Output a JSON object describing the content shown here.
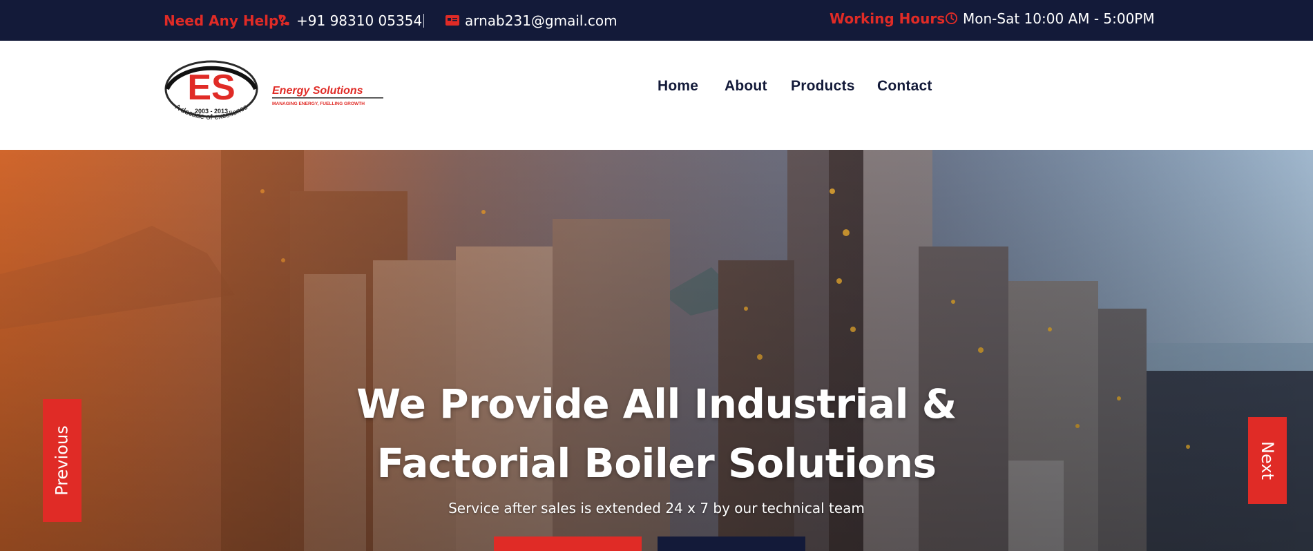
{
  "topbar": {
    "help_label": "Need Any Help?",
    "phone": "+91 98310 05354",
    "email": "arnab231@gmail.com",
    "working_hours_label": "Working Hours",
    "hours": "Mon-Sat 10:00 AM - 5:00PM",
    "icons": [
      "phone-icon",
      "email-icon",
      "clock-icon"
    ]
  },
  "logo": {
    "mark": "ES",
    "years": "2003 - 2013",
    "tagline_arc": "A decade of excellence",
    "name": "Energy Solutions",
    "slogan": "MANAGING ENERGY, FUELLING GROWTH"
  },
  "nav": {
    "items": [
      {
        "label": "Home"
      },
      {
        "label": "About"
      },
      {
        "label": "Products"
      },
      {
        "label": "Contact"
      }
    ]
  },
  "hero": {
    "title_line1": "We Provide All Industrial &",
    "title_line2": "Factorial Boiler Solutions",
    "subtitle": "Service after sales is extended 24 x 7 by our technical team",
    "prev_label": "Previous",
    "next_label": "Next"
  },
  "colors": {
    "navy": "#131a39",
    "accent_red": "#e02b26",
    "white": "#ffffff"
  }
}
